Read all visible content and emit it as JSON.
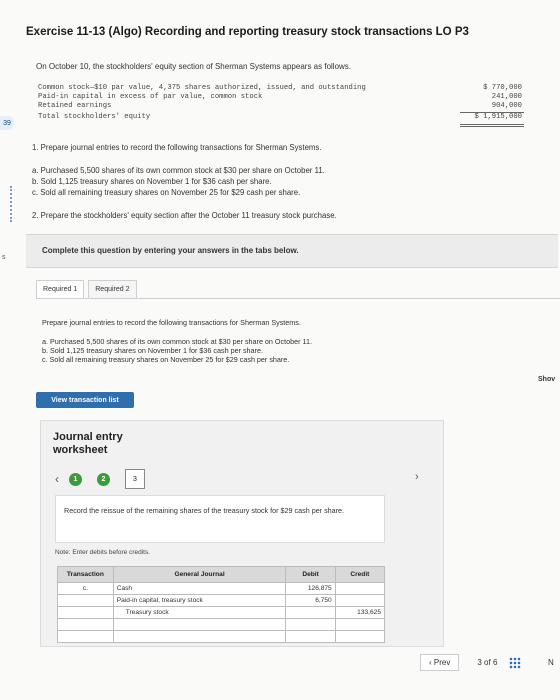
{
  "title": "Exercise 11-13 (Algo) Recording and reporting treasury stock transactions LO P3",
  "intro": "On October 10, the stockholders' equity section of Sherman Systems appears as follows.",
  "equity": {
    "rows": [
      {
        "label": "Common stock—$10 par value, 4,375 shares authorized, issued, and outstanding",
        "value": "$ 770,000"
      },
      {
        "label": "Paid-in capital in excess of par value, common stock",
        "value": "241,000"
      },
      {
        "label": "Retained earnings",
        "value": "904,000"
      },
      {
        "label": "Total stockholders' equity",
        "value": "$ 1,915,000"
      }
    ]
  },
  "questions": {
    "q1": "1. Prepare journal entries to record the following transactions for Sherman Systems.",
    "qa": "a. Purchased 5,500 shares of its own common stock at $30 per share on October 11.",
    "qb": "b. Sold 1,125 treasury shares on November 1 for $36 cash per share.",
    "qc": "c. Sold all remaining treasury shares on November 25 for $29 cash per share.",
    "q2": "2. Prepare the stockholders' equity section after the October 11 treasury stock purchase."
  },
  "left_tab": "39",
  "left_tab2": "s",
  "complete_text": "Complete this question by entering your answers in the tabs below.",
  "tabs": [
    "Required 1",
    "Required 2"
  ],
  "required_text": {
    "main": "Prepare journal entries to record the following transactions for Sherman Systems.",
    "a": "a. Purchased 5,500 shares of its own common stock at $30 per share on October 11.",
    "b": "b. Sold 1,125 treasury shares on November 1 for $36 cash per share.",
    "c": "c. Sold all remaining treasury shares on November 25 for $29 cash per share."
  },
  "show_link": "Shov",
  "view_button": "View transaction list",
  "worksheet": {
    "title": "Journal entry worksheet",
    "steps": [
      "1",
      "2",
      "3"
    ],
    "instruction": "Record the reissue of the remaining shares of the treasury stock for $29 cash per share.",
    "note": "Note: Enter debits before credits.",
    "headers": {
      "transaction": "Transaction",
      "general_journal": "General Journal",
      "debit": "Debit",
      "credit": "Credit"
    },
    "rows": [
      {
        "transaction": "c.",
        "account": "Cash",
        "debit": "126,875",
        "credit": ""
      },
      {
        "transaction": "",
        "account": "Paid-in capital, treasury stock",
        "debit": "6,750",
        "credit": ""
      },
      {
        "transaction": "",
        "account": "Treasury stock",
        "debit": "",
        "credit": "133,625"
      },
      {
        "transaction": "",
        "account": "",
        "debit": "",
        "credit": ""
      },
      {
        "transaction": "",
        "account": "",
        "debit": "",
        "credit": ""
      }
    ]
  },
  "pager": {
    "prev": "Prev",
    "current": "3",
    "of_label": "of",
    "total": "6",
    "next": "N"
  }
}
